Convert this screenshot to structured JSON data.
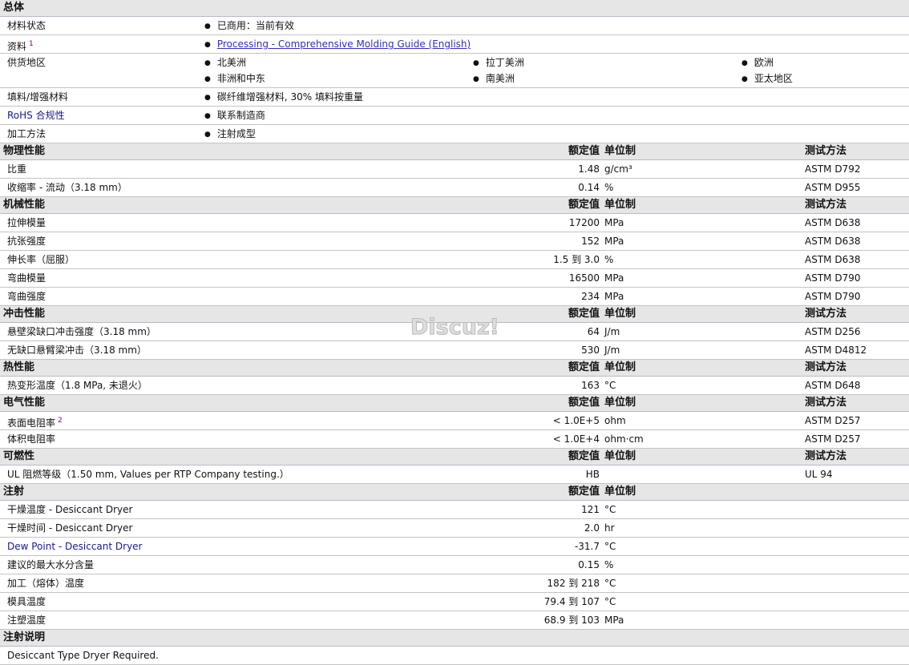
{
  "general": {
    "title": "总体",
    "rows": [
      {
        "label": "材料状态",
        "items": [
          "已商用：当前有效"
        ]
      },
      {
        "label": "资料",
        "sup": "1",
        "link": "Processing - Comprehensive Molding Guide (English)"
      },
      {
        "label": "供货地区",
        "items": [
          "北美洲",
          "拉丁美洲",
          "欧洲",
          "非洲和中东",
          "南美洲",
          "亚太地区"
        ]
      },
      {
        "label": "填料/增强材料",
        "items": [
          "碳纤维增强材料, 30% 填料按重量"
        ]
      },
      {
        "label": "RoHS 合规性",
        "items": [
          "联系制造商"
        ]
      },
      {
        "label": "加工方法",
        "items": [
          "注射成型"
        ]
      }
    ]
  },
  "columns": {
    "value": "额定值",
    "unit": "单位制",
    "method": "测试方法"
  },
  "sections": [
    {
      "title": "物理性能",
      "method_col": true,
      "rows": [
        {
          "label": "比重",
          "value": "1.48",
          "unit": "g/cm³",
          "method": "ASTM D792"
        },
        {
          "label": "收缩率 - 流动（3.18 mm）",
          "value": "0.14",
          "unit": "%",
          "method": "ASTM D955"
        }
      ]
    },
    {
      "title": "机械性能",
      "method_col": true,
      "rows": [
        {
          "label": "拉伸模量",
          "value": "17200",
          "unit": "MPa",
          "method": "ASTM D638"
        },
        {
          "label": "抗张强度",
          "value": "152",
          "unit": "MPa",
          "method": "ASTM D638"
        },
        {
          "label": "伸长率（屈服）",
          "value": "1.5 到  3.0",
          "unit": "%",
          "method": "ASTM D638"
        },
        {
          "label": "弯曲模量",
          "value": "16500",
          "unit": "MPa",
          "method": "ASTM D790"
        },
        {
          "label": "弯曲强度",
          "value": "234",
          "unit": "MPa",
          "method": "ASTM D790"
        }
      ]
    },
    {
      "title": "冲击性能",
      "method_col": true,
      "rows": [
        {
          "label": "悬壁梁缺口冲击强度（3.18 mm）",
          "value": "64",
          "unit": "J/m",
          "method": "ASTM D256"
        },
        {
          "label": "无缺口悬臂梁冲击（3.18 mm）",
          "value": "530",
          "unit": "J/m",
          "method": "ASTM D4812"
        }
      ]
    },
    {
      "title": "热性能",
      "method_col": true,
      "rows": [
        {
          "label": "热变形温度（1.8 MPa, 未退火）",
          "value": "163",
          "unit": "°C",
          "method": "ASTM D648"
        }
      ]
    },
    {
      "title": "电气性能",
      "method_col": true,
      "rows": [
        {
          "label": "表面电阻率",
          "sup": "2",
          "value": "< 1.0E+5",
          "unit": "ohm",
          "method": "ASTM D257"
        },
        {
          "label": "体积电阻率",
          "value": "< 1.0E+4",
          "unit": "ohm·cm",
          "method": "ASTM D257"
        }
      ]
    },
    {
      "title": "可燃性",
      "method_col": true,
      "rows": [
        {
          "label": "UL 阻燃等级（1.50 mm, Values per RTP Company testing.）",
          "value": "HB",
          "unit": "",
          "method": "UL 94"
        }
      ]
    },
    {
      "title": "注射",
      "method_col": false,
      "rows": [
        {
          "label": "干燥温度 - Desiccant Dryer",
          "value": "121",
          "unit": "°C"
        },
        {
          "label": "干燥时间 - Desiccant Dryer",
          "value": "2.0",
          "unit": "hr"
        },
        {
          "label": "Dew Point - Desiccant Dryer",
          "value": "-31.7",
          "unit": "°C",
          "accent": true
        },
        {
          "label": "建议的最大水分含量",
          "value": "0.15",
          "unit": "%"
        },
        {
          "label": "加工（熔体）温度",
          "value": "182 到  218",
          "unit": "°C"
        },
        {
          "label": "模具温度",
          "value": "79.4 到  107",
          "unit": "°C"
        },
        {
          "label": "注塑温度",
          "value": "68.9 到  103",
          "unit": "MPa"
        }
      ]
    }
  ],
  "notes": {
    "title": "注射说明",
    "text": "Desiccant Type Dryer Required."
  },
  "watermark": "Discuz!"
}
